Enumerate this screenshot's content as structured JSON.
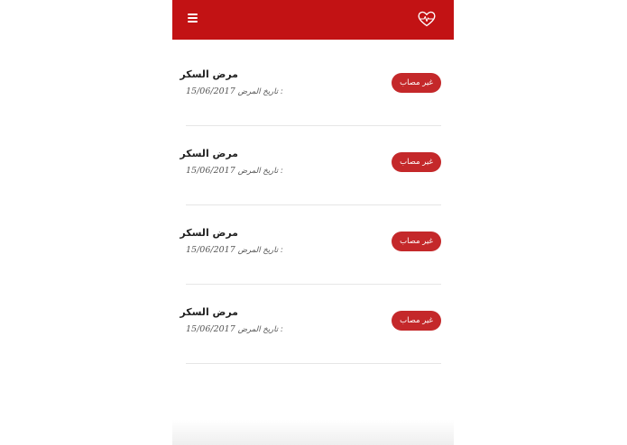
{
  "colors": {
    "primary": "#c21214",
    "badge": "#c4282a"
  },
  "appbar": {
    "menu_icon": "hamburger-menu-icon",
    "logo_icon": "heart-pulse-logo-icon"
  },
  "records": [
    {
      "title": "مرض السكر",
      "date_label": "تاريخ المرض :",
      "date": "15/06/2017",
      "status": "غير مصاب"
    },
    {
      "title": "مرض السكر",
      "date_label": "تاريخ المرض :",
      "date": "15/06/2017",
      "status": "غير مصاب"
    },
    {
      "title": "مرض السكر",
      "date_label": "تاريخ المرض :",
      "date": "15/06/2017",
      "status": "غير مصاب"
    },
    {
      "title": "مرض السكر",
      "date_label": "تاريخ المرض :",
      "date": "15/06/2017",
      "status": "غير مصاب"
    }
  ]
}
